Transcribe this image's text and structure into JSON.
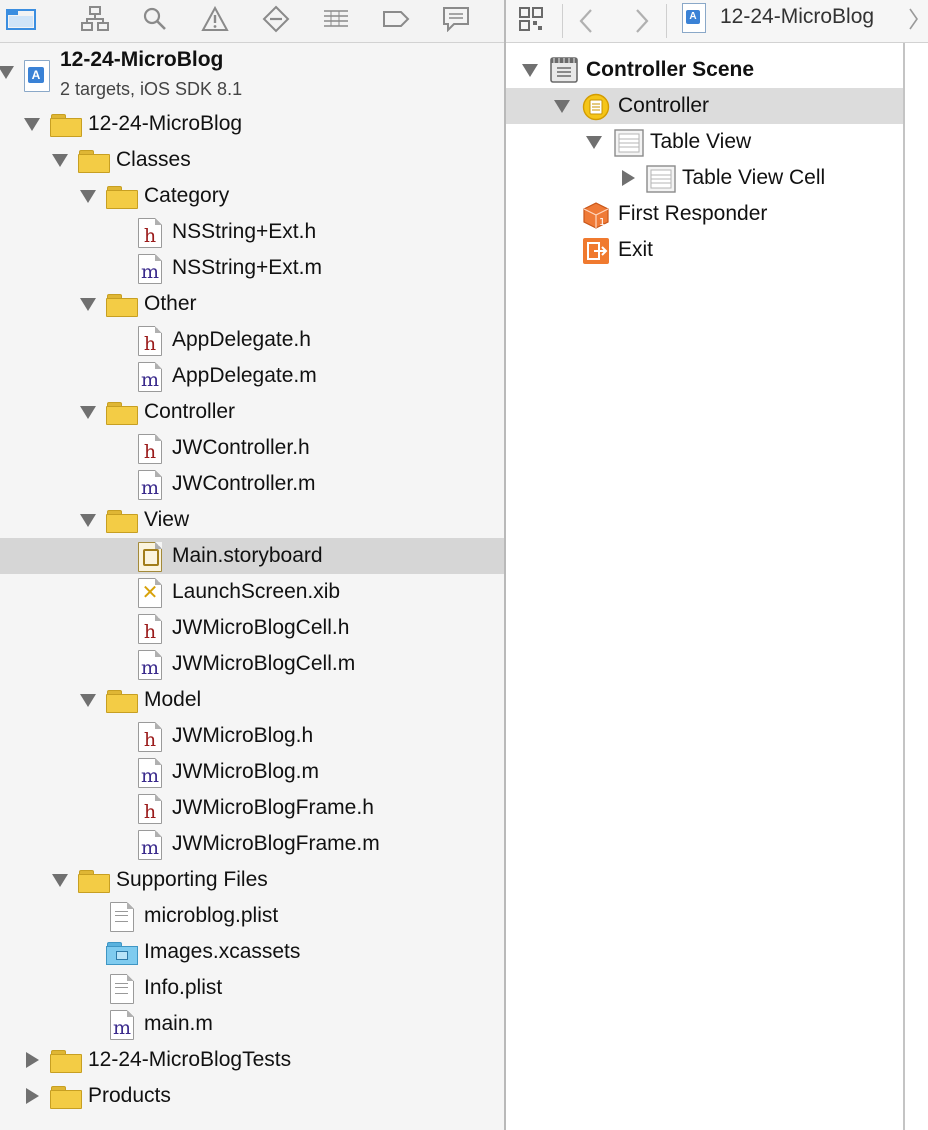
{
  "navigator_toolbar": {
    "icons": [
      "project-navigator-icon",
      "symbol-navigator-icon",
      "find-navigator-icon",
      "issue-navigator-icon",
      "test-navigator-icon",
      "debug-navigator-icon",
      "breakpoint-navigator-icon",
      "report-navigator-icon"
    ]
  },
  "project": {
    "name": "12-24-MicroBlog",
    "subtitle": "2 targets, iOS SDK 8.1"
  },
  "tree": [
    {
      "label": "12-24-MicroBlog",
      "type": "folder",
      "depth": 0,
      "expanded": true
    },
    {
      "label": "Classes",
      "type": "folder",
      "depth": 1,
      "expanded": true
    },
    {
      "label": "Category",
      "type": "folder",
      "depth": 2,
      "expanded": true
    },
    {
      "label": "NSString+Ext.h",
      "type": "h",
      "depth": 3
    },
    {
      "label": "NSString+Ext.m",
      "type": "m",
      "depth": 3
    },
    {
      "label": "Other",
      "type": "folder",
      "depth": 2,
      "expanded": true
    },
    {
      "label": "AppDelegate.h",
      "type": "h",
      "depth": 3
    },
    {
      "label": "AppDelegate.m",
      "type": "m",
      "depth": 3
    },
    {
      "label": "Controller",
      "type": "folder",
      "depth": 2,
      "expanded": true
    },
    {
      "label": "JWController.h",
      "type": "h",
      "depth": 3
    },
    {
      "label": "JWController.m",
      "type": "m",
      "depth": 3
    },
    {
      "label": "View",
      "type": "folder",
      "depth": 2,
      "expanded": true
    },
    {
      "label": "Main.storyboard",
      "type": "storyboard",
      "depth": 3,
      "selected": true
    },
    {
      "label": "LaunchScreen.xib",
      "type": "xib",
      "depth": 3
    },
    {
      "label": "JWMicroBlogCell.h",
      "type": "h",
      "depth": 3
    },
    {
      "label": "JWMicroBlogCell.m",
      "type": "m",
      "depth": 3
    },
    {
      "label": "Model",
      "type": "folder",
      "depth": 2,
      "expanded": true
    },
    {
      "label": "JWMicroBlog.h",
      "type": "h",
      "depth": 3
    },
    {
      "label": "JWMicroBlog.m",
      "type": "m",
      "depth": 3
    },
    {
      "label": "JWMicroBlogFrame.h",
      "type": "h",
      "depth": 3
    },
    {
      "label": "JWMicroBlogFrame.m",
      "type": "m",
      "depth": 3
    },
    {
      "label": "Supporting Files",
      "type": "folder",
      "depth": 1,
      "expanded": true
    },
    {
      "label": "microblog.plist",
      "type": "plist",
      "depth": 2
    },
    {
      "label": "Images.xcassets",
      "type": "xcassets",
      "depth": 2
    },
    {
      "label": "Info.plist",
      "type": "plist",
      "depth": 2
    },
    {
      "label": "main.m",
      "type": "m",
      "depth": 2
    },
    {
      "label": "12-24-MicroBlogTests",
      "type": "folder",
      "depth": 0,
      "expanded": false
    },
    {
      "label": "Products",
      "type": "folder",
      "depth": 0,
      "expanded": false
    }
  ],
  "jumpbar": {
    "breadcrumb_project": "12-24-MicroBlog"
  },
  "outline": [
    {
      "label": "Controller Scene",
      "type": "scene",
      "depth": 0,
      "expanded": true,
      "bold": true
    },
    {
      "label": "Controller",
      "type": "controller",
      "depth": 1,
      "expanded": true,
      "selected": true
    },
    {
      "label": "Table View",
      "type": "tableview",
      "depth": 2,
      "expanded": true
    },
    {
      "label": "Table View Cell",
      "type": "tablecell",
      "depth": 3,
      "expanded": false
    },
    {
      "label": "First Responder",
      "type": "firstresponder",
      "depth": 1
    },
    {
      "label": "Exit",
      "type": "exit",
      "depth": 1
    }
  ],
  "colors": {
    "selection": "#d6d6d6",
    "folder": "#f3cc45",
    "h_letter": "#9b1c1c",
    "m_letter": "#3a2a8c",
    "accent_blue": "#3a82d6",
    "exit_orange": "#f07a2f"
  }
}
